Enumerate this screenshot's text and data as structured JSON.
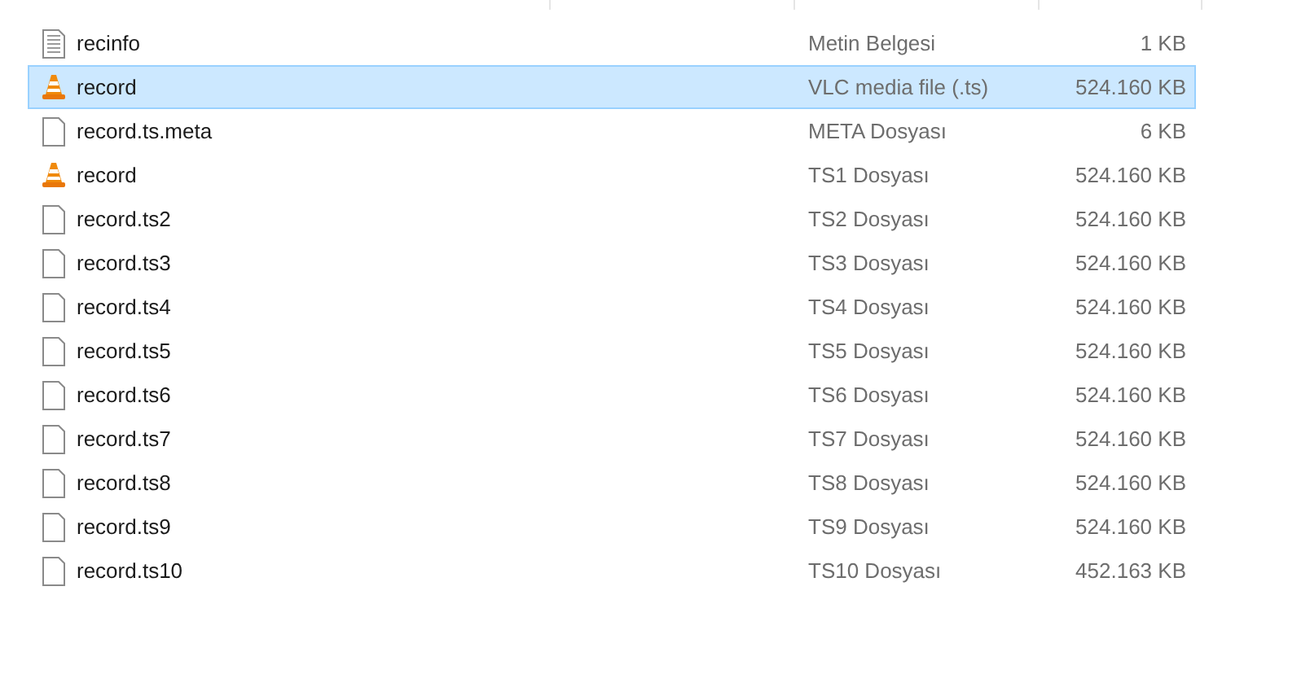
{
  "files": [
    {
      "name": "recinfo",
      "kind": "text",
      "type": "Metin Belgesi",
      "size": "1 KB",
      "selected": false
    },
    {
      "name": "record",
      "kind": "vlc",
      "type": "VLC media file (.ts)",
      "size": "524.160 KB",
      "selected": true
    },
    {
      "name": "record.ts.meta",
      "kind": "blank",
      "type": "META Dosyası",
      "size": "6 KB",
      "selected": false
    },
    {
      "name": "record",
      "kind": "vlc",
      "type": "TS1 Dosyası",
      "size": "524.160 KB",
      "selected": false
    },
    {
      "name": "record.ts2",
      "kind": "blank",
      "type": "TS2 Dosyası",
      "size": "524.160 KB",
      "selected": false
    },
    {
      "name": "record.ts3",
      "kind": "blank",
      "type": "TS3 Dosyası",
      "size": "524.160 KB",
      "selected": false
    },
    {
      "name": "record.ts4",
      "kind": "blank",
      "type": "TS4 Dosyası",
      "size": "524.160 KB",
      "selected": false
    },
    {
      "name": "record.ts5",
      "kind": "blank",
      "type": "TS5 Dosyası",
      "size": "524.160 KB",
      "selected": false
    },
    {
      "name": "record.ts6",
      "kind": "blank",
      "type": "TS6 Dosyası",
      "size": "524.160 KB",
      "selected": false
    },
    {
      "name": "record.ts7",
      "kind": "blank",
      "type": "TS7 Dosyası",
      "size": "524.160 KB",
      "selected": false
    },
    {
      "name": "record.ts8",
      "kind": "blank",
      "type": "TS8 Dosyası",
      "size": "524.160 KB",
      "selected": false
    },
    {
      "name": "record.ts9",
      "kind": "blank",
      "type": "TS9 Dosyası",
      "size": "524.160 KB",
      "selected": false
    },
    {
      "name": "record.ts10",
      "kind": "blank",
      "type": "TS10 Dosyası",
      "size": "452.163 KB",
      "selected": false
    }
  ]
}
